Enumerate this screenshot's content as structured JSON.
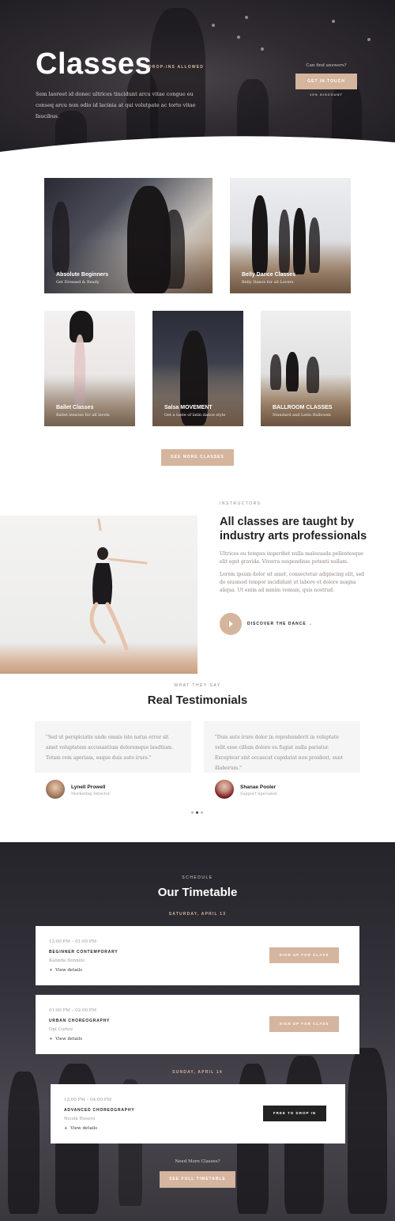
{
  "hero": {
    "title": "Classes",
    "tag": "DROP-INS ALLOWED",
    "description": "Sem laoreet id donec ultrices tincidunt arcu vitae congue eu conseq arcu non odio id lacinia at qui volutpate ac torto vitae faucibus.",
    "question": "Can find answers?",
    "cta_label": "GET IN TOUCH",
    "discount": "10% DISCOUNT"
  },
  "classes": {
    "cards": [
      {
        "title": "Absolute Beginners",
        "subtitle": "Get Dressed & Ready"
      },
      {
        "title": "Belly Dance Classes",
        "subtitle": "Belly Dance for all Lovers"
      },
      {
        "title": "Ballet Classes",
        "subtitle": "Ballet lessons for all levels"
      },
      {
        "title": "Salsa MOVEMENT",
        "subtitle": "Get a taste of latin dance style"
      },
      {
        "title": "BALLROOM CLASSES",
        "subtitle": "Standard and Latin Ballroom"
      }
    ],
    "more_label": "SEE MORE CLASSES"
  },
  "instructors": {
    "eyebrow": "INSTRUCTORS",
    "title": "All classes are taught by industry arts professionals",
    "p1": "Ultrices eu tempus imperdiet nulla malesuada pellentesque elit eget gravida. Viverra suspendisse potenti nullam.",
    "p2": "Lorem ipsum dolor sit amet, consectetur adipiscing elit, sed do eiusmod tempor incididunt ut labore et dolore magna aliqua. Ut enim ad minim veniam, quis nostrud.",
    "discover_label": "DISCOVER THE DANCE →"
  },
  "testimonials": {
    "eyebrow": "WHAT THEY SAY",
    "title": "Real Testimonials",
    "items": [
      {
        "quote": "\"Sed ut perspiciatis unde omnis iste natus error sit amet voluptatem accusantium doloremque laudtium. Totam rem aperiam, eaque duis aute irure.\"",
        "name": "Lynell Prowell",
        "role": "Marketing Director"
      },
      {
        "quote": "\"Duis aute irure dolor in reprehenderit in voluptate velit esse cillum dolore eu fugiat nulla pariatur. Excepteur sint occaecat cupidatat non proident, sunt illaborum.\"",
        "name": "Shanae Pooler",
        "role": "Support Specialist"
      }
    ]
  },
  "timetable": {
    "eyebrow": "SCHEDULE",
    "title": "Our Timetable",
    "days": [
      {
        "label": "SATURDAY, APRIL 13",
        "slots": [
          {
            "time": "12:00 PM – 01:00 PM",
            "name": "BEGINNER CONTEMPORARY",
            "instructor": "Kalinda Donnini",
            "details": "View details",
            "button": "SIGN UP FOR CLASS"
          },
          {
            "time": "01:00 PM – 02:00 PM",
            "name": "URBAN CHOREOGRAPHY",
            "instructor": "Opi Curtez",
            "details": "View details",
            "button": "SIGN UP FOR CLASS"
          }
        ]
      },
      {
        "label": "SUNDAY, APRIL 14",
        "slots": [
          {
            "time": "12:00 PM – 04:00 PM",
            "name": "ADVANCED CHOREOGRAPHY",
            "instructor": "Nicole Rosero",
            "details": "View details",
            "button": "FREE TO DROP IN"
          }
        ]
      }
    ],
    "need_more": "Need More Classes?",
    "full_label": "SEE FULL TIMETABLE"
  },
  "colors": {
    "accent": "#d5b59e",
    "dark": "#222222"
  }
}
